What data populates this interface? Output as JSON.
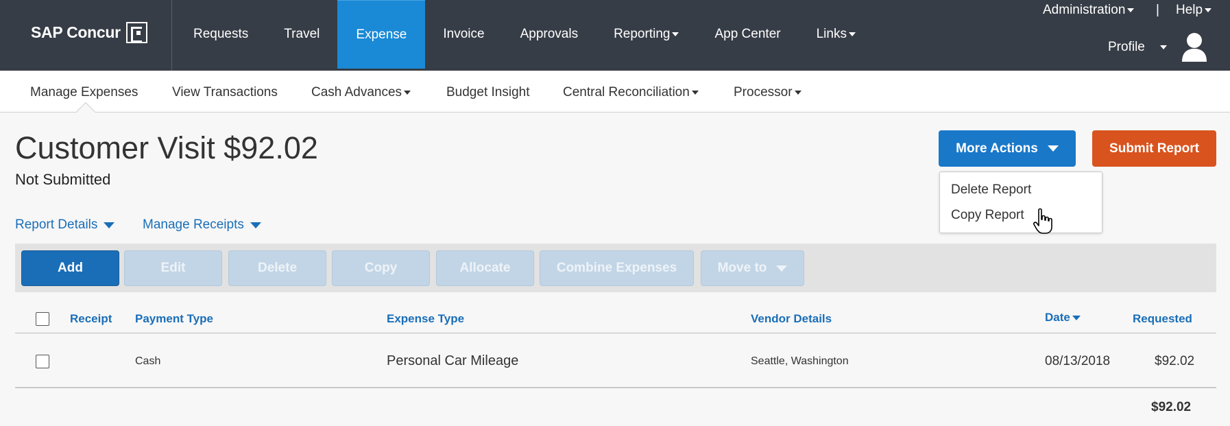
{
  "brand": {
    "name": "SAP Concur"
  },
  "main_nav": {
    "items": [
      {
        "label": "Requests"
      },
      {
        "label": "Travel"
      },
      {
        "label": "Expense",
        "active": true
      },
      {
        "label": "Invoice"
      },
      {
        "label": "Approvals"
      },
      {
        "label": "Reporting"
      },
      {
        "label": "App Center"
      },
      {
        "label": "Links"
      }
    ]
  },
  "utility": {
    "administration": "Administration",
    "separator": "|",
    "help": "Help",
    "profile": "Profile"
  },
  "sub_nav": {
    "items": [
      {
        "label": "Manage Expenses",
        "active": true
      },
      {
        "label": "View Transactions"
      },
      {
        "label": "Cash Advances"
      },
      {
        "label": "Budget Insight"
      },
      {
        "label": "Central Reconciliation"
      },
      {
        "label": "Processor"
      }
    ]
  },
  "report": {
    "title": "Customer Visit $92.02",
    "status": "Not Submitted"
  },
  "actions": {
    "more_actions": "More Actions",
    "submit": "Submit Report",
    "menu": [
      "Delete Report",
      "Copy Report"
    ]
  },
  "report_links": {
    "details": "Report Details",
    "receipts": "Manage Receipts"
  },
  "toolbar": {
    "add": "Add",
    "edit": "Edit",
    "delete": "Delete",
    "copy": "Copy",
    "allocate": "Allocate",
    "combine": "Combine Expenses",
    "move_to": "Move to"
  },
  "table": {
    "headers": {
      "receipt": "Receipt",
      "payment_type": "Payment Type",
      "expense_type": "Expense Type",
      "vendor": "Vendor Details",
      "date": "Date",
      "requested": "Requested"
    },
    "rows": [
      {
        "payment_type": "Cash",
        "expense_type": "Personal Car Mileage",
        "vendor": "Seattle, Washington",
        "date": "08/13/2018",
        "requested": "$92.02"
      }
    ],
    "total": "$92.02"
  },
  "colors": {
    "topbar": "#373d46",
    "active_nav": "#1a8ad6",
    "primary": "#1a78c9",
    "submit": "#d9531e",
    "link": "#1a6eb7"
  }
}
